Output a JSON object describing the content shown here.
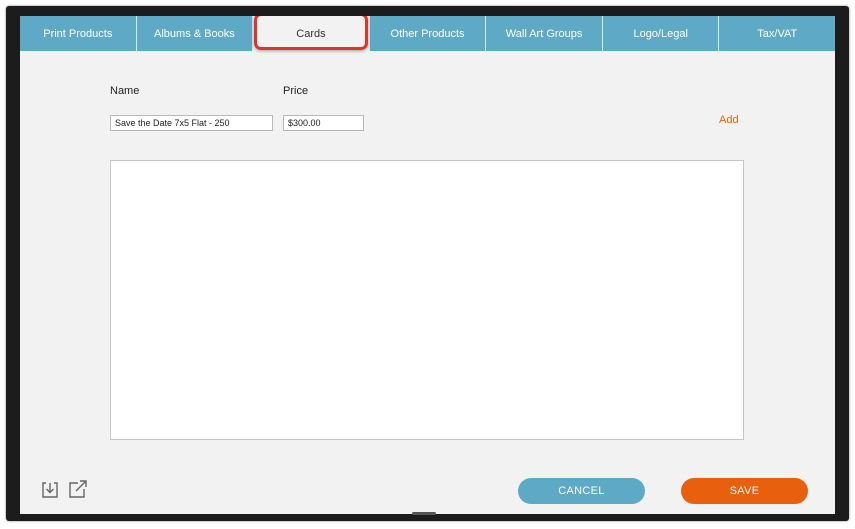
{
  "tabs": [
    {
      "label": "Print Products",
      "active": false
    },
    {
      "label": "Albums & Books",
      "active": false
    },
    {
      "label": "Cards",
      "active": true
    },
    {
      "label": "Other Products",
      "active": false
    },
    {
      "label": "Wall Art Groups",
      "active": false
    },
    {
      "label": "Logo/Legal",
      "active": false
    },
    {
      "label": "Tax/VAT",
      "active": false
    }
  ],
  "form": {
    "name_label": "Name",
    "price_label": "Price",
    "name_value": "Save the Date 7x5 Flat - 250",
    "price_value": "$300.00",
    "add_label": "Add"
  },
  "icons": {
    "import": "import-icon",
    "export": "export-icon"
  },
  "buttons": {
    "cancel_label": "CANCEL",
    "save_label": "SAVE"
  },
  "colors": {
    "tab_bar": "#5ea9c6",
    "highlight": "#e0332a",
    "accent": "#e8600e",
    "cancel": "#5ea9c6"
  }
}
